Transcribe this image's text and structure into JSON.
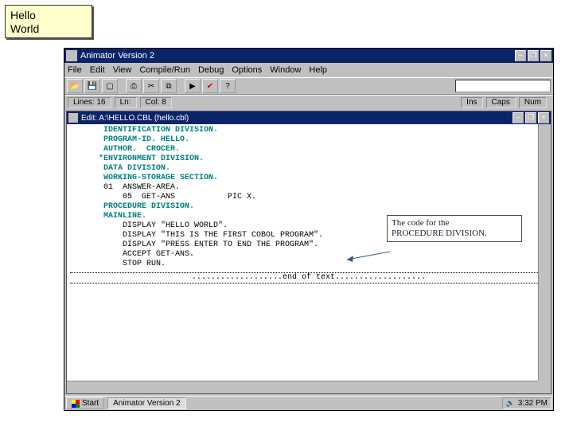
{
  "hello_box": {
    "line1": "Hello",
    "line2": "World"
  },
  "window": {
    "title": "Animator Version 2",
    "minimize": "–",
    "restore": "❐",
    "close": "×"
  },
  "menu": {
    "file": "File",
    "edit": "Edit",
    "view": "View",
    "compile": "Compile/Run",
    "debug": "Debug",
    "options": "Options",
    "window": "Window",
    "help": "Help"
  },
  "toolbar": {
    "open": "📂",
    "save": "💾",
    "new": "▢",
    "print": "⎙",
    "cut": "✂",
    "copy": "⧉",
    "run": "▶",
    "check": "✔",
    "help": "?"
  },
  "status": {
    "lines_label": "Lines:",
    "lines_val": "16",
    "ln_label": "Ln:",
    "ln_val": "",
    "col_label": "Col:",
    "col_val": "8",
    "ins": "Ins",
    "caps": "Caps",
    "num": "Num"
  },
  "inner": {
    "title": "Edit: A:\\HELLO.CBL (hello.cbl)"
  },
  "code_lines": [
    {
      "cls": "kw",
      "text": "       IDENTIFICATION DIVISION."
    },
    {
      "cls": "kw",
      "text": "       PROGRAM-ID. HELLO."
    },
    {
      "cls": "kw",
      "text": "       AUTHOR.  CROCER."
    },
    {
      "cls": "kw",
      "text": "      *ENVIRONMENT DIVISION."
    },
    {
      "cls": "kw",
      "text": "       DATA DIVISION."
    },
    {
      "cls": "kw",
      "text": "       WORKING-STORAGE SECTION."
    },
    {
      "cls": "plain",
      "text": "       01  ANSWER-AREA."
    },
    {
      "cls": "plain",
      "text": "           05  GET-ANS           PIC X."
    },
    {
      "cls": "kw",
      "text": "       PROCEDURE DIVISION."
    },
    {
      "cls": "kw",
      "text": "       MAINLINE."
    },
    {
      "cls": "plain",
      "text": "           DISPLAY \"HELLO WORLD\"."
    },
    {
      "cls": "plain",
      "text": "           DISPLAY \"THIS IS THE FIRST COBOL PROGRAM\"."
    },
    {
      "cls": "plain",
      "text": "           DISPLAY \"PRESS ENTER TO END THE PROGRAM\"."
    },
    {
      "cls": "plain",
      "text": "           ACCEPT GET-ANS."
    },
    {
      "cls": "plain",
      "text": "           STOP RUN."
    }
  ],
  "end_of_text": "end of text",
  "callout": {
    "line1": "The code for the",
    "line2": "PROCEDURE DIVISION."
  },
  "taskbar": {
    "start": "Start",
    "task1": "Animator Version 2",
    "time": "3:32 PM"
  }
}
